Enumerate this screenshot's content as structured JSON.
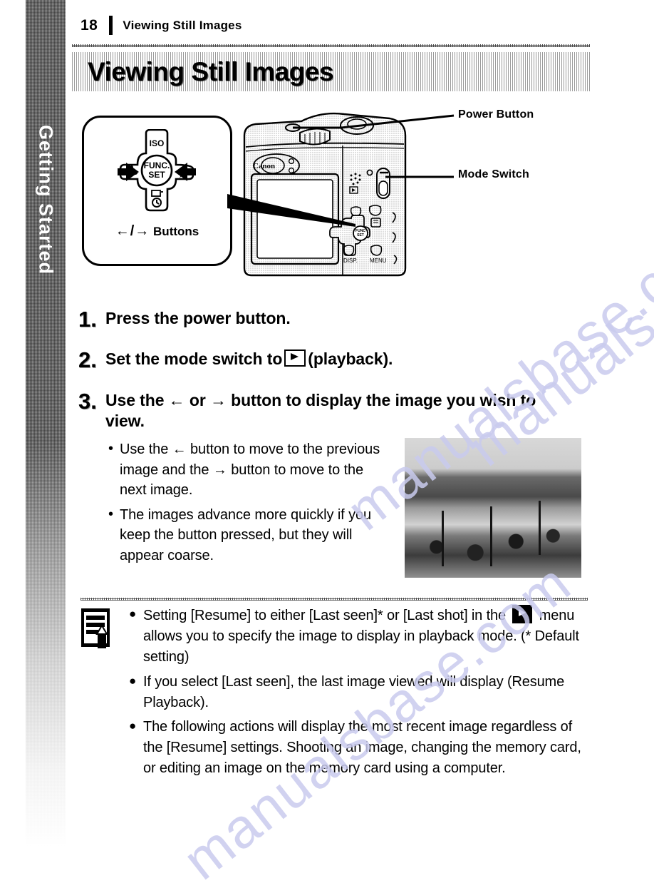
{
  "sidebar": {
    "chapter_label": "Getting Started"
  },
  "header": {
    "page_number": "18",
    "running_title": "Viewing Still Images"
  },
  "title_banner": {
    "title": "Viewing Still Images"
  },
  "diagram": {
    "callout": {
      "dpad_center_line1": "FUNC.",
      "dpad_center_line2": "SET",
      "dpad_top_label": "ISO",
      "dpad_left_icon": "macro-flower-icon",
      "dpad_right_icon": "flash-icon",
      "dpad_bottom_icon": "self-timer-icon",
      "dpad_bottom_inner_icon": "drive-mode-icon",
      "buttons_label": "Buttons",
      "buttons_arrows": "←/→"
    },
    "camera": {
      "brand": "Canon",
      "disp_label": "DISP.",
      "menu_label": "MENU"
    },
    "labels": {
      "power_button": "Power Button",
      "mode_switch": "Mode Switch"
    }
  },
  "steps": [
    {
      "number": "1.",
      "text_before": "Press the power button.",
      "has_icon": false,
      "text_after": ""
    },
    {
      "number": "2.",
      "text_before": "Set the mode switch to",
      "has_icon": true,
      "icon": "playback-icon",
      "text_after": "(playback)."
    },
    {
      "number": "3.",
      "text_before": "Use the ← or → button to display the image you wish to view.",
      "has_icon": false,
      "text_after": ""
    }
  ],
  "bullets": [
    {
      "marker": "•",
      "text": "Use the ← button to move to the previous image and the → button to move to the next image."
    },
    {
      "marker": "•",
      "text": "The images advance more quickly if you keep the button pressed, but they will appear coarse."
    }
  ],
  "sample_photo": {
    "alt": "beach scene with parasols"
  },
  "note": {
    "icon": "note-pencil-icon",
    "items": [
      {
        "marker": "●",
        "text_before": "Setting [Resume] to either [Last seen]* or [Last shot] in the",
        "has_icon": true,
        "icon": "playback-menu-icon",
        "text_after": "menu allows you to specify the image to display in playback mode. (* Default setting)"
      },
      {
        "marker": "●",
        "text_before": "If you select [Last seen], the last image viewed will display (Resume Playback).",
        "has_icon": false,
        "text_after": ""
      },
      {
        "marker": "●",
        "text_before": "The following actions will display the most recent image regardless of the [Resume] settings. Shooting an image, changing the memory card, or editing an image on the memory card using a computer.",
        "has_icon": false,
        "text_after": ""
      }
    ]
  },
  "watermark": {
    "line1": "manualsbase.com",
    "line2": "manuals.com",
    "color": "#c9cbee"
  }
}
